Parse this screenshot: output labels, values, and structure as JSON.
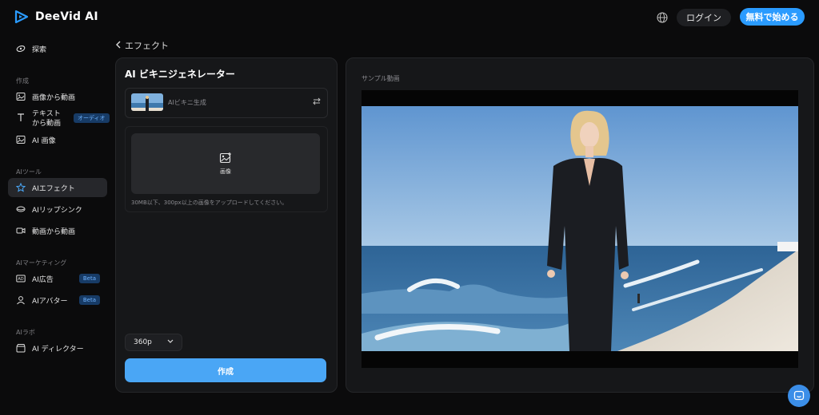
{
  "brand": {
    "name": "DeeVid AI",
    "accent": "#2a9bff"
  },
  "header": {
    "login_label": "ログイン",
    "start_label": "無料で始める"
  },
  "sidebar": {
    "explore": "探索",
    "sections": {
      "create": "作成",
      "ai_tools": "AIツール",
      "ai_marketing": "AIマーケティング",
      "ai_lab": "AIラボ"
    },
    "items": {
      "image_to_video": "画像から動画",
      "text_to_video": "テキストから動画",
      "text_to_video_badge": "オーディオ",
      "ai_image": "AI 画像",
      "ai_effect": "AIエフェクト",
      "ai_lipsync": "AIリップシンク",
      "video_to_video": "動画から動画",
      "ai_ads": "AI広告",
      "ai_ads_badge": "Beta",
      "ai_avatar": "AIアバター",
      "ai_avatar_badge": "Beta",
      "ai_director": "AI ディレクター"
    }
  },
  "breadcrumb": {
    "label": "エフェクト"
  },
  "generator": {
    "title": "AI ビキニジェネレーター",
    "model_name": "AIビキニ生成",
    "upload_label": "画像",
    "upload_note": "30MB以下、300px以上の画像をアップロードしてください。",
    "resolution": "360p",
    "create_label": "作成"
  },
  "preview": {
    "label": "サンプル動画"
  }
}
